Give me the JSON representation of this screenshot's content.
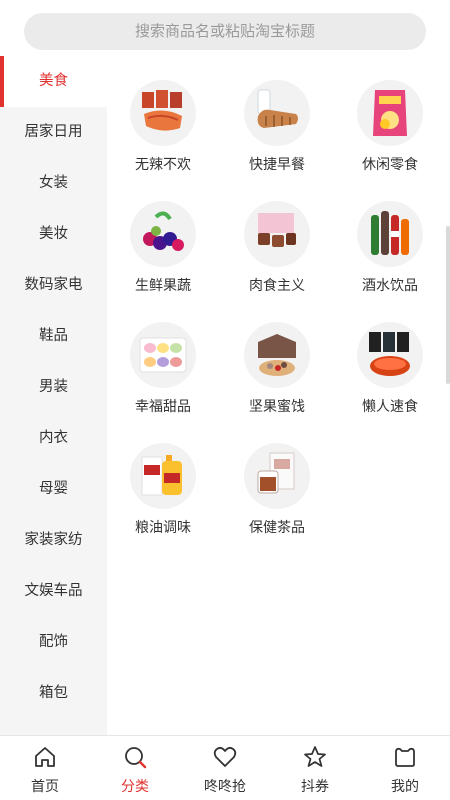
{
  "search": {
    "placeholder": "搜索商品名或粘贴淘宝标题"
  },
  "sidebar": {
    "items": [
      {
        "label": "美食",
        "active": true
      },
      {
        "label": "居家日用"
      },
      {
        "label": "女装"
      },
      {
        "label": "美妆"
      },
      {
        "label": "数码家电"
      },
      {
        "label": "鞋品"
      },
      {
        "label": "男装"
      },
      {
        "label": "内衣"
      },
      {
        "label": "母婴"
      },
      {
        "label": "家装家纺"
      },
      {
        "label": "文娱车品"
      },
      {
        "label": "配饰"
      },
      {
        "label": "箱包"
      }
    ]
  },
  "categories": [
    {
      "label": "无辣不欢",
      "icon": "spicy-snacks-icon"
    },
    {
      "label": "快捷早餐",
      "icon": "bread-milk-icon"
    },
    {
      "label": "休闲零食",
      "icon": "chips-bag-icon"
    },
    {
      "label": "生鲜果蔬",
      "icon": "berries-icon"
    },
    {
      "label": "肉食主义",
      "icon": "meat-cubes-icon"
    },
    {
      "label": "酒水饮品",
      "icon": "drink-bottles-icon"
    },
    {
      "label": "幸福甜品",
      "icon": "macarons-icon"
    },
    {
      "label": "坚果蜜饯",
      "icon": "nuts-box-icon"
    },
    {
      "label": "懒人速食",
      "icon": "instant-noodles-icon"
    },
    {
      "label": "粮油调味",
      "icon": "rice-oil-icon"
    },
    {
      "label": "保健茶品",
      "icon": "tea-box-icon"
    }
  ],
  "tabbar": {
    "items": [
      {
        "label": "首页",
        "icon": "home-icon"
      },
      {
        "label": "分类",
        "icon": "search-icon",
        "active": true
      },
      {
        "label": "咚咚抢",
        "icon": "heart-icon"
      },
      {
        "label": "抖券",
        "icon": "star-icon"
      },
      {
        "label": "我的",
        "icon": "profile-icon"
      }
    ]
  },
  "colors": {
    "accent": "#e0322f",
    "sidebar_bg": "#f5f5f5",
    "search_bg": "#ebebeb"
  }
}
